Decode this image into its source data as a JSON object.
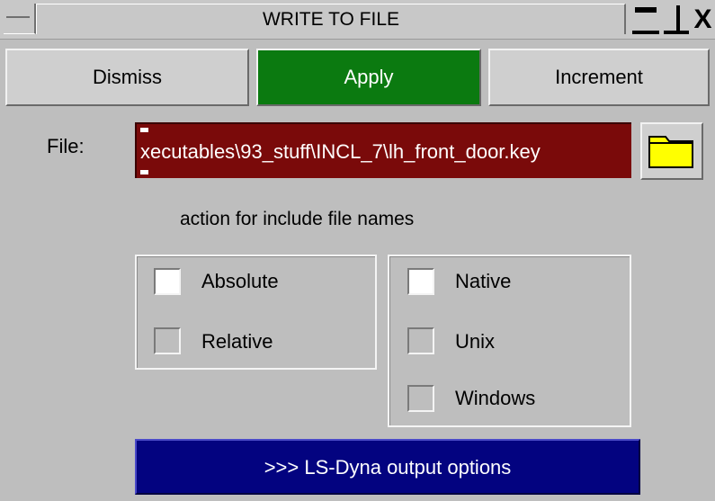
{
  "window": {
    "title": "WRITE TO FILE",
    "controls": {
      "minimize_icon": "minimize-icon",
      "maximize_icon": "maximize-icon",
      "close_glyph": "X"
    }
  },
  "toolbar": {
    "dismiss_label": "Dismiss",
    "apply_label": "Apply",
    "increment_label": "Increment"
  },
  "file": {
    "label": "File:",
    "value": "xecutables\\93_stuff\\INCL_7\\lh_front_door.key",
    "browse_icon": "folder-icon"
  },
  "include_action": {
    "heading": "action for include file names",
    "path_options": [
      {
        "label": "Absolute",
        "checked": true
      },
      {
        "label": "Relative",
        "checked": false
      }
    ],
    "os_options": [
      {
        "label": "Native",
        "checked": true
      },
      {
        "label": "Unix",
        "checked": false
      },
      {
        "label": "Windows",
        "checked": false
      }
    ]
  },
  "output_options_label": ">>> LS-Dyna output options",
  "colors": {
    "background": "#bebebe",
    "apply": "#0b7a10",
    "file_field": "#7a0a0a",
    "output_button": "#030380",
    "folder": "#ffff00"
  }
}
